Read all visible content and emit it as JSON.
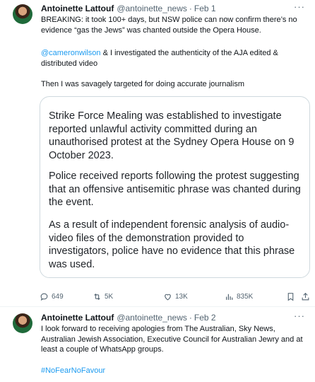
{
  "tweets": [
    {
      "author_name": "Antoinette Lattouf",
      "handle": "@antoinette_news",
      "separator": "·",
      "date": "Feb 1",
      "more": "···",
      "text1": "BREAKING: it took 100+ days, but NSW police can now confirm there’s no evidence “gas the Jews” was chanted outside the Opera House.",
      "mention": "@cameronwilson",
      "text2_rest": " & I investigated the authenticity of the AJA edited & distributed video",
      "text3": "Then I was savagely targeted for doing accurate journalism",
      "card": {
        "p1": "Strike Force Mealing was established to investigate reported unlawful activity committed during an unauthorised protest at the Sydney Opera House on 9 October 2023.",
        "p2": "Police received reports following the protest suggesting that an offensive antisemitic phrase was chanted during the event.",
        "p3": "As a result of independent forensic analysis of audio-video files of the demonstration provided to investigators, police have no evidence that this phrase was used."
      },
      "actions": {
        "replies": "649",
        "reposts": "5K",
        "likes": "13K",
        "views": "835K"
      },
      "icons": {
        "reply": "reply-icon",
        "repost": "repost-icon",
        "like": "heart-icon",
        "views": "views-chart-icon",
        "bookmark": "bookmark-icon",
        "share": "share-icon"
      },
      "accent_color": "#1d9bf0"
    },
    {
      "author_name": "Antoinette Lattouf",
      "handle": "@antoinette_news",
      "separator": "·",
      "date": "Feb 2",
      "more": "···",
      "text1": "I look forward to receiving apologies from The Australian, Sky News, Australian Jewish Association, Executive Council for Australian Jewry and at least a couple of WhatsApp groups.",
      "hashtag": "#NoFearNoFavour"
    }
  ]
}
